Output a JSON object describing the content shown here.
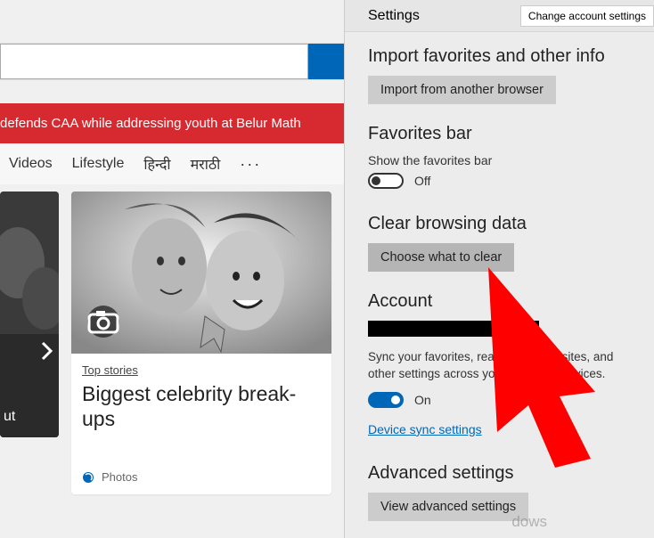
{
  "left": {
    "banner": "defends CAA while addressing youth at Belur Math",
    "tabs": [
      "Videos",
      "Lifestyle",
      "हिन्दी",
      "मराठी"
    ],
    "more": "···",
    "ut": "ut",
    "card": {
      "topStories": "Top stories",
      "title": "Biggest celebrity break-ups",
      "source": "Photos"
    }
  },
  "settings": {
    "header": "Settings",
    "changeAccount": "Change account settings",
    "importTitle": "Import favorites and other info",
    "importBtn": "Import from another browser",
    "favBarTitle": "Favorites bar",
    "favBarLabel": "Show the favorites bar",
    "favBarToggle": "Off",
    "clearTitle": "Clear browsing data",
    "clearBtn": "Choose what to clear",
    "accountTitle": "Account",
    "syncText": "Sync your favorites, reading list, top sites, and other settings across your Windows devices.",
    "syncToggle": "On",
    "syncLink": "Device sync settings",
    "advTitle": "Advanced settings",
    "advBtn": "View advanced settings",
    "watermark": "dows"
  }
}
